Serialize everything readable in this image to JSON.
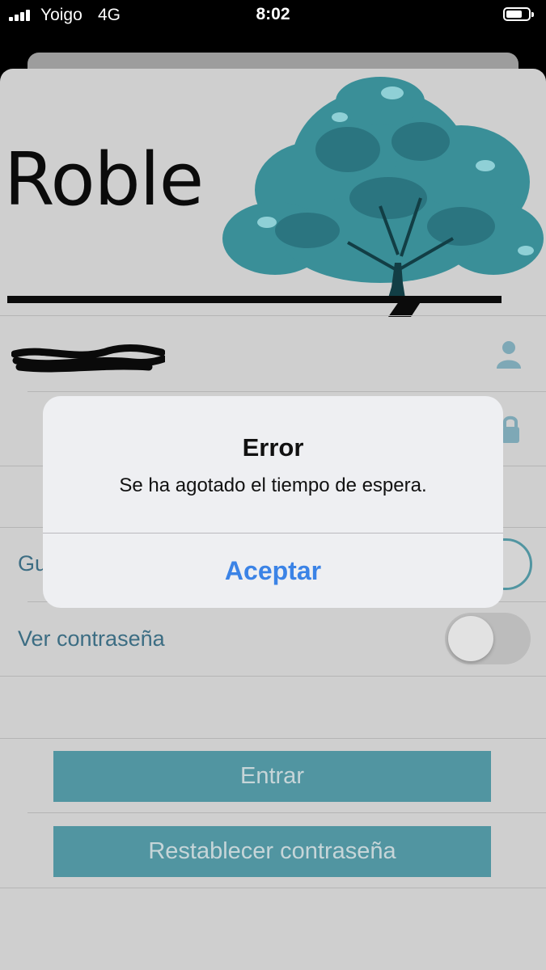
{
  "status_bar": {
    "carrier": "Yoigo",
    "network": "4G",
    "time": "8:02"
  },
  "app": {
    "logo_text": "Roble",
    "username_value": "",
    "settings": [
      {
        "label": "Guardar contraseña",
        "visible_label": "Gu",
        "on": false
      },
      {
        "label": "Ver contraseña",
        "visible_label": "Ver contraseña",
        "on": false
      }
    ],
    "login_button": "Entrar",
    "reset_button": "Restablecer contraseña"
  },
  "alert": {
    "title": "Error",
    "message": "Se ha agotado el tiempo de espera.",
    "button": "Aceptar"
  },
  "icons": {
    "user": "person-icon",
    "lock": "lock-icon",
    "logo": "oak-tree-icon"
  },
  "colors": {
    "accent": "#5195a1",
    "label": "#3c6d83",
    "alert_button": "#3b83e6",
    "tree": "#3a8f98"
  }
}
